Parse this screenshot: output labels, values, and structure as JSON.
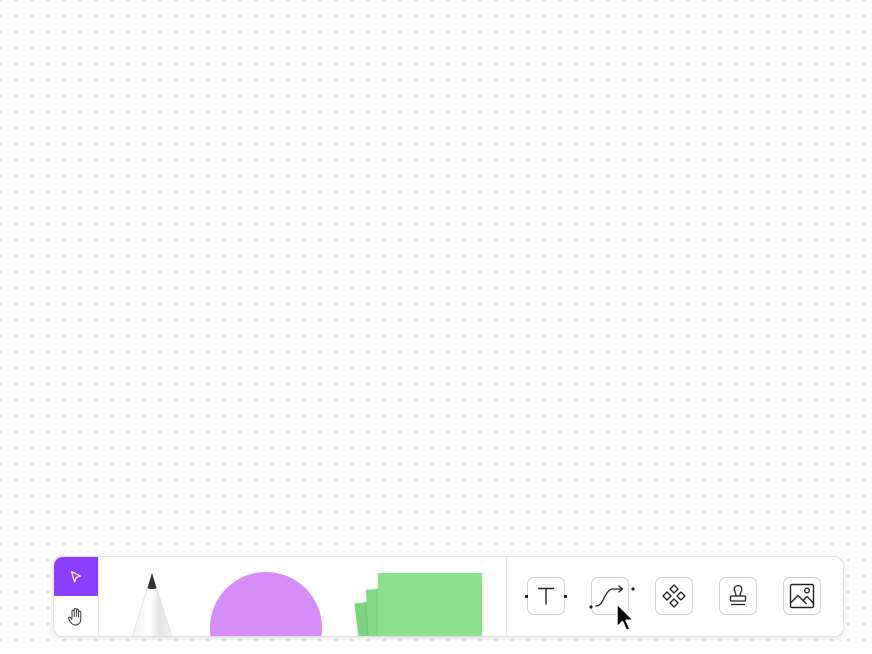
{
  "app": {
    "canvas_background": "#ffffff",
    "dot_grid_color": "#d9d9d9"
  },
  "toolbar": {
    "navigation": {
      "select_tool": {
        "icon": "pointer-arrow-icon",
        "active": true,
        "active_color": "#8a3ffc"
      },
      "hand_tool": {
        "icon": "hand-icon",
        "active": false
      }
    },
    "creation_tools": {
      "pen": {
        "icon": "pencil-icon",
        "tip_color": "#333333"
      },
      "shape": {
        "icon": "circle-shape-icon",
        "color": "#d68cf9"
      },
      "sticky_note": {
        "icon": "sticky-notes-icon",
        "color": "#8de18c"
      }
    },
    "insert_tools": [
      {
        "id": "text",
        "icon": "text-t-icon"
      },
      {
        "id": "connector",
        "icon": "connector-curve-icon"
      },
      {
        "id": "components",
        "icon": "components-diamonds-icon"
      },
      {
        "id": "stamp",
        "icon": "stamp-icon"
      },
      {
        "id": "image",
        "icon": "image-icon"
      }
    ]
  },
  "pointer": {
    "icon": "mouse-cursor-icon",
    "hovering": "connector"
  }
}
